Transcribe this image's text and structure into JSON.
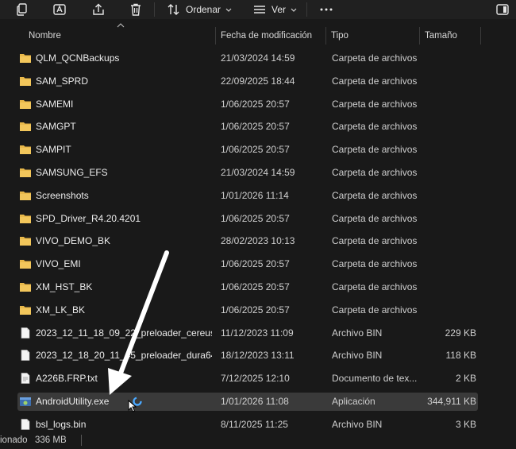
{
  "toolbar": {
    "sort_label": "Ordenar",
    "view_label": "Ver"
  },
  "columns": {
    "name": "Nombre",
    "date": "Fecha de modificación",
    "type": "Tipo",
    "size": "Tamaño"
  },
  "rows": [
    {
      "icon": "folder-icon",
      "name": "QLM_QCNBackups",
      "date": "21/03/2024 14:59",
      "type": "Carpeta de archivos",
      "size": ""
    },
    {
      "icon": "folder-icon",
      "name": "SAM_SPRD",
      "date": "22/09/2025 18:44",
      "type": "Carpeta de archivos",
      "size": ""
    },
    {
      "icon": "folder-icon",
      "name": "SAMEMI",
      "date": "1/06/2025 20:57",
      "type": "Carpeta de archivos",
      "size": ""
    },
    {
      "icon": "folder-icon",
      "name": "SAMGPT",
      "date": "1/06/2025 20:57",
      "type": "Carpeta de archivos",
      "size": ""
    },
    {
      "icon": "folder-icon",
      "name": "SAMPIT",
      "date": "1/06/2025 20:57",
      "type": "Carpeta de archivos",
      "size": ""
    },
    {
      "icon": "folder-icon",
      "name": "SAMSUNG_EFS",
      "date": "21/03/2024 14:59",
      "type": "Carpeta de archivos",
      "size": ""
    },
    {
      "icon": "folder-icon",
      "name": "Screenshots",
      "date": "1/01/2026 11:14",
      "type": "Carpeta de archivos",
      "size": ""
    },
    {
      "icon": "folder-icon",
      "name": "SPD_Driver_R4.20.4201",
      "date": "1/06/2025 20:57",
      "type": "Carpeta de archivos",
      "size": ""
    },
    {
      "icon": "folder-icon",
      "name": "VIVO_DEMO_BK",
      "date": "28/02/2023 10:13",
      "type": "Carpeta de archivos",
      "size": ""
    },
    {
      "icon": "folder-icon",
      "name": "VIVO_EMI",
      "date": "1/06/2025 20:57",
      "type": "Carpeta de archivos",
      "size": ""
    },
    {
      "icon": "folder-icon",
      "name": "XM_HST_BK",
      "date": "1/06/2025 20:57",
      "type": "Carpeta de archivos",
      "size": ""
    },
    {
      "icon": "folder-icon",
      "name": "XM_LK_BK",
      "date": "1/06/2025 20:57",
      "type": "Carpeta de archivos",
      "size": ""
    },
    {
      "icon": "file-icon",
      "name": "2023_12_11_18_09_22_preloader_cereus.b...",
      "date": "11/12/2023 11:09",
      "type": "Archivo BIN",
      "size": "229 KB"
    },
    {
      "icon": "file-icon",
      "name": "2023_12_18_20_11_45_preloader_dura64...",
      "date": "18/12/2023 13:11",
      "type": "Archivo BIN",
      "size": "118 KB"
    },
    {
      "icon": "text-file-icon",
      "name": "A226B.FRP.txt",
      "date": "7/12/2025 12:10",
      "type": "Documento de tex...",
      "size": "2 KB"
    },
    {
      "icon": "exe-icon",
      "name": "AndroidUtility.exe",
      "date": "1/01/2026 11:08",
      "type": "Aplicación",
      "size": "344,911 KB",
      "selected": true
    },
    {
      "icon": "file-icon",
      "name": "bsl_logs.bin",
      "date": "8/11/2025 11:25",
      "type": "Archivo BIN",
      "size": "3 KB"
    }
  ],
  "status": {
    "selected_text": "ionado",
    "selected_size": "336 MB"
  },
  "colors": {
    "folder": "#e8b84a",
    "accent": "#4aa8ff",
    "selected_bg": "#3a3a3a"
  }
}
